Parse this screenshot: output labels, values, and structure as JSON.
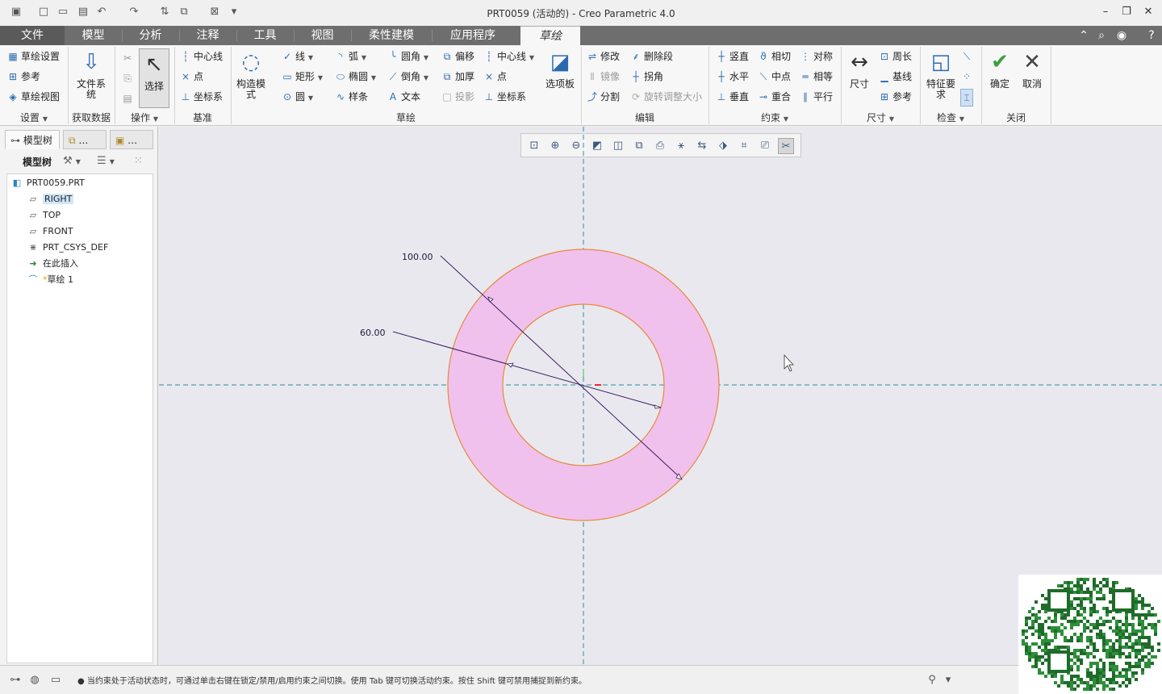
{
  "window": {
    "title": "PRT0059 (活动的) - Creo Parametric 4.0"
  },
  "tabs": [
    {
      "label": "文件"
    },
    {
      "label": "模型"
    },
    {
      "label": "分析"
    },
    {
      "label": "注释"
    },
    {
      "label": "工具"
    },
    {
      "label": "视图"
    },
    {
      "label": "柔性建模"
    },
    {
      "label": "应用程序"
    },
    {
      "label": "草绘"
    }
  ],
  "ribbon": {
    "setup": {
      "items": [
        "草绘设置",
        "参考",
        "草绘视图"
      ],
      "group": "设置"
    },
    "getdata": {
      "big": "文件系统",
      "group": "获取数据"
    },
    "operations": {
      "big": "选择",
      "group": "操作"
    },
    "datum": {
      "items": [
        "中心线",
        "点",
        "坐标系"
      ],
      "group": "基准"
    },
    "sketch": {
      "construction": "构造模式",
      "col1": [
        "线",
        "矩形",
        "圆"
      ],
      "col2": [
        "弧",
        "椭圆",
        "样条"
      ],
      "col3": [
        "圆角",
        "倒角",
        "文本"
      ],
      "col4": [
        "偏移",
        "加厚",
        "投影"
      ],
      "col5": [
        "中心线",
        "点",
        "坐标系"
      ],
      "palette": "选项板",
      "group": "草绘"
    },
    "edit": {
      "col1": [
        "修改",
        "镜像",
        "分割"
      ],
      "col2": [
        "删除段",
        "拐角",
        "旋转调整大小"
      ],
      "group": "编辑"
    },
    "constrain": {
      "col1": [
        "竖直",
        "水平",
        "垂直"
      ],
      "col2": [
        "相切",
        "中点",
        "重合"
      ],
      "col3": [
        "对称",
        "相等",
        "平行"
      ],
      "group": "约束"
    },
    "dimension": {
      "big": "尺寸",
      "items": [
        "周长",
        "基线",
        "参考"
      ],
      "group": "尺寸"
    },
    "inspect": {
      "big": "特征要求",
      "group": "检查"
    },
    "close": {
      "ok": "确定",
      "cancel": "取消",
      "group": "关闭"
    }
  },
  "left_panel": {
    "tabs": [
      "模型树",
      "…",
      "…"
    ],
    "toolbar_label": "模型树",
    "tree": [
      {
        "label": "PRT0059.PRT",
        "icon": "part-icon"
      },
      {
        "label": "RIGHT",
        "icon": "datum-plane-icon"
      },
      {
        "label": "TOP",
        "icon": "datum-plane-icon"
      },
      {
        "label": "FRONT",
        "icon": "datum-plane-icon"
      },
      {
        "label": "PRT_CSYS_DEF",
        "icon": "csys-icon"
      },
      {
        "label": "在此插入",
        "icon": "insert-arrow-icon"
      },
      {
        "label": "草绘 1",
        "icon": "sketch-icon"
      }
    ]
  },
  "canvas": {
    "dimensions": [
      {
        "label": "100.00",
        "value": 100.0,
        "kind": "diameter",
        "ref": "outer-circle"
      },
      {
        "label": "60.00",
        "value": 60.0,
        "kind": "diameter",
        "ref": "inner-circle"
      }
    ],
    "fill_color": "#f0c1ec",
    "circle_color": "#e8893a",
    "centerline_color": "#2a8fa0",
    "background_color": "#e9e8ef"
  },
  "status": {
    "message": "● 当约束处于活动状态时，可通过单击右键在锁定/禁用/启用约束之间切换。使用 Tab 键可切换活动约束。按住 Shift 键可禁用捕捉到新约束。"
  }
}
